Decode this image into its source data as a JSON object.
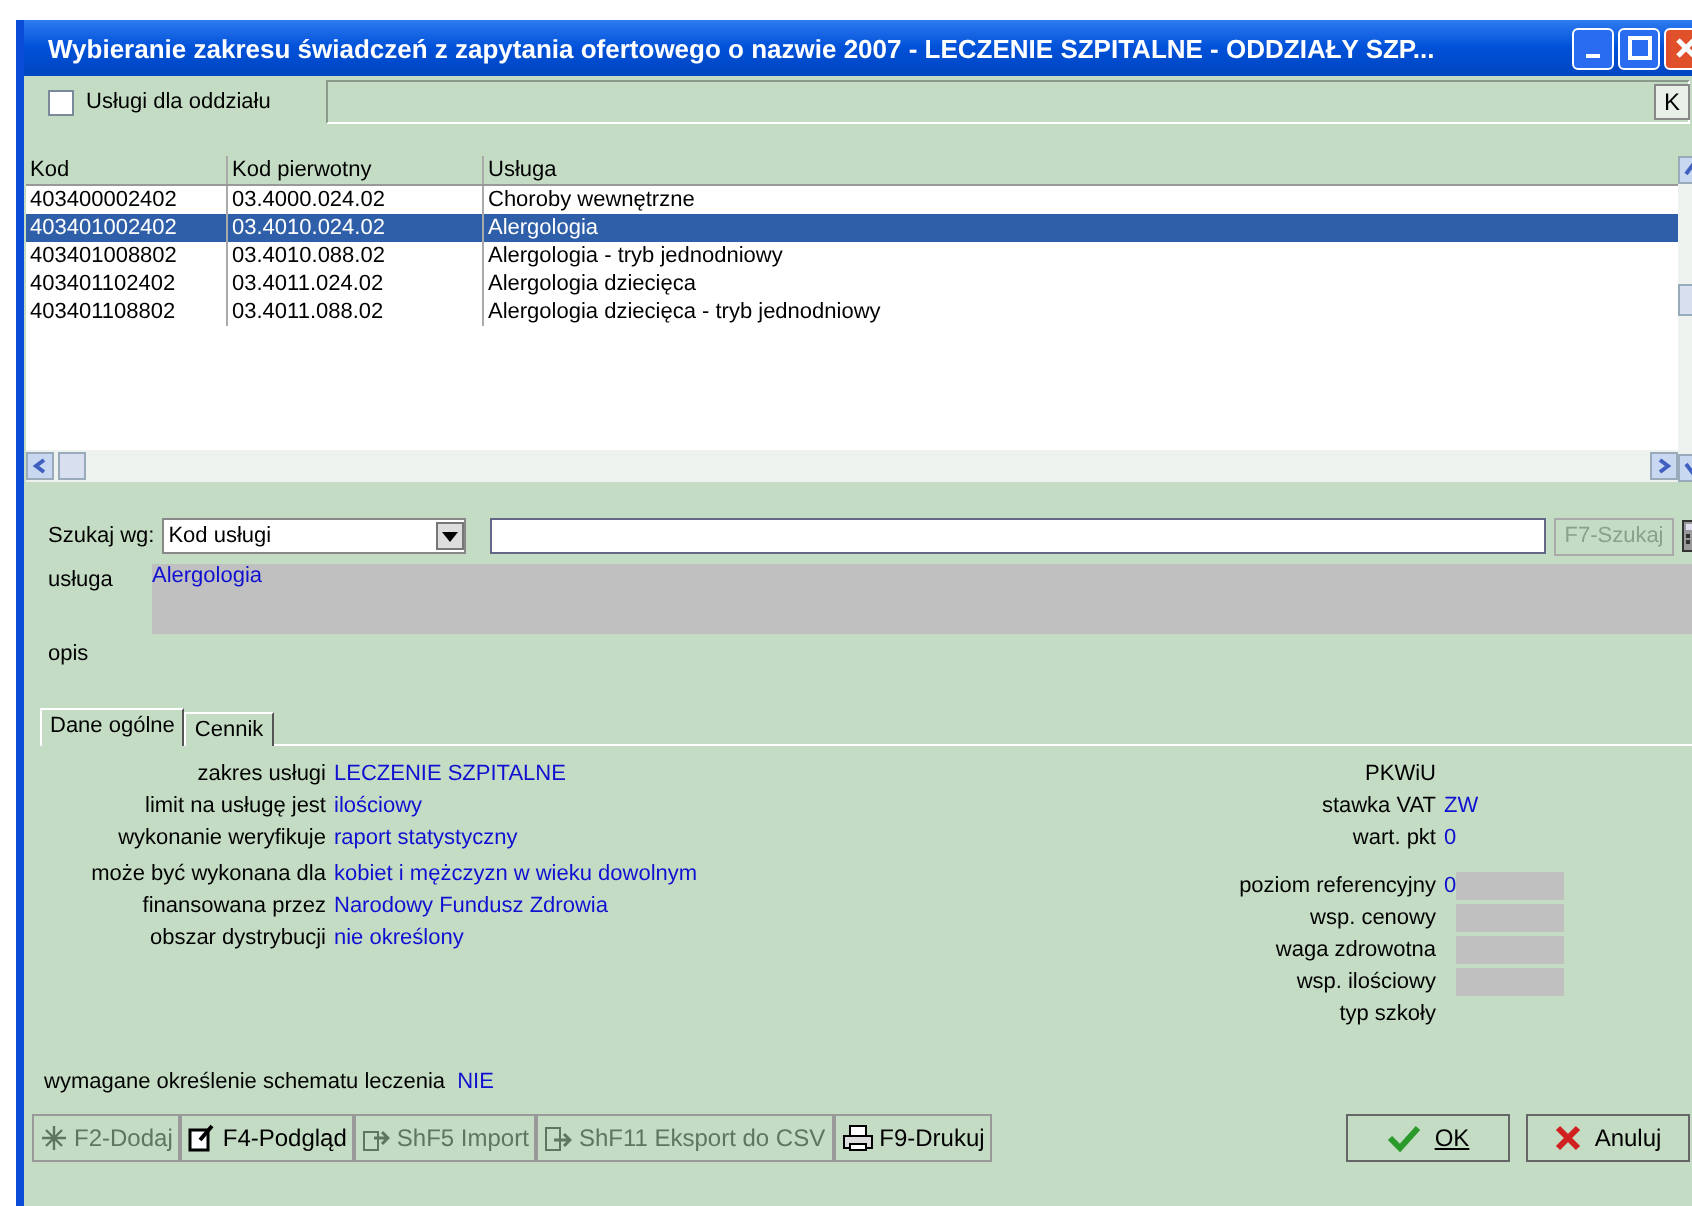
{
  "window": {
    "title": "Wybieranie zakresu świadczeń z zapytania ofertowego o nazwie 2007 - LECZENIE SZPITALNE - ODDZIAŁY SZP..."
  },
  "filter": {
    "label": "Usługi dla oddziału",
    "checked": false,
    "button": "K"
  },
  "table": {
    "columns": [
      "Kod",
      "Kod pierwotny",
      "Usługa"
    ],
    "rows": [
      {
        "cells": [
          "403400002402",
          "03.4000.024.02",
          "Choroby wewnętrzne"
        ],
        "selected": false
      },
      {
        "cells": [
          "403401002402",
          "03.4010.024.02",
          "Alergologia"
        ],
        "selected": true
      },
      {
        "cells": [
          "403401008802",
          "03.4010.088.02",
          "Alergologia - tryb jednodniowy"
        ],
        "selected": false
      },
      {
        "cells": [
          "403401102402",
          "03.4011.024.02",
          "Alergologia dziecięca"
        ],
        "selected": false
      },
      {
        "cells": [
          "403401108802",
          "03.4011.088.02",
          "Alergologia dziecięca - tryb jednodniowy"
        ],
        "selected": false
      }
    ]
  },
  "search": {
    "label": "Szukaj wg:",
    "dropdown": "Kod usługi",
    "button": "F7-Szukaj",
    "button_disabled": true
  },
  "service": {
    "label": "usługa",
    "value": "Alergologia"
  },
  "description": {
    "label": "opis"
  },
  "tabs": [
    {
      "label": "Dane ogólne",
      "selected": true
    },
    {
      "label": "Cennik",
      "selected": false
    }
  ],
  "details_left": [
    {
      "label": "zakres usługi",
      "value": "LECZENIE SZPITALNE"
    },
    {
      "label": "limit na usługę jest",
      "value": "ilościowy"
    },
    {
      "label": "wykonanie weryfikuje",
      "value": "raport statystyczny"
    },
    {
      "label": "może być wykonana dla",
      "value": "kobiet i mężczyzn w wieku dowolnym"
    },
    {
      "label": "finansowana przez",
      "value": "Narodowy Fundusz Zdrowia"
    },
    {
      "label": "obszar dystrybucji",
      "value": "nie określony"
    }
  ],
  "details_right": [
    {
      "label": "PKWiU",
      "kind": "plain"
    },
    {
      "label": "stawka VAT",
      "value": "ZW",
      "kind": "plain"
    },
    {
      "label": "wart. pkt",
      "value": "0",
      "kind": "plain"
    },
    {
      "label": "poziom referencyjny",
      "value": "0",
      "kind": "field"
    },
    {
      "label": "wsp. cenowy",
      "kind": "field"
    },
    {
      "label": "waga zdrowotna",
      "kind": "field"
    },
    {
      "label": "wsp. ilościowy",
      "kind": "field"
    },
    {
      "label": "typ szkoły",
      "kind": "plain"
    }
  ],
  "footer": {
    "label": "wymagane określenie schematu leczenia",
    "value": "NIE"
  },
  "toolbar": [
    {
      "label": "F2-Dodaj",
      "disabled": true
    },
    {
      "label": "F4-Podgląd",
      "disabled": false
    },
    {
      "label": "ShF5 Import",
      "disabled": true
    },
    {
      "label": "ShF11 Eksport do CSV",
      "disabled": true
    },
    {
      "label": "F9-Drukuj",
      "disabled": false
    }
  ],
  "dialog_buttons": [
    {
      "label": "OK",
      "kind": "ok"
    },
    {
      "label": "Anuluj",
      "kind": "cancel"
    }
  ]
}
